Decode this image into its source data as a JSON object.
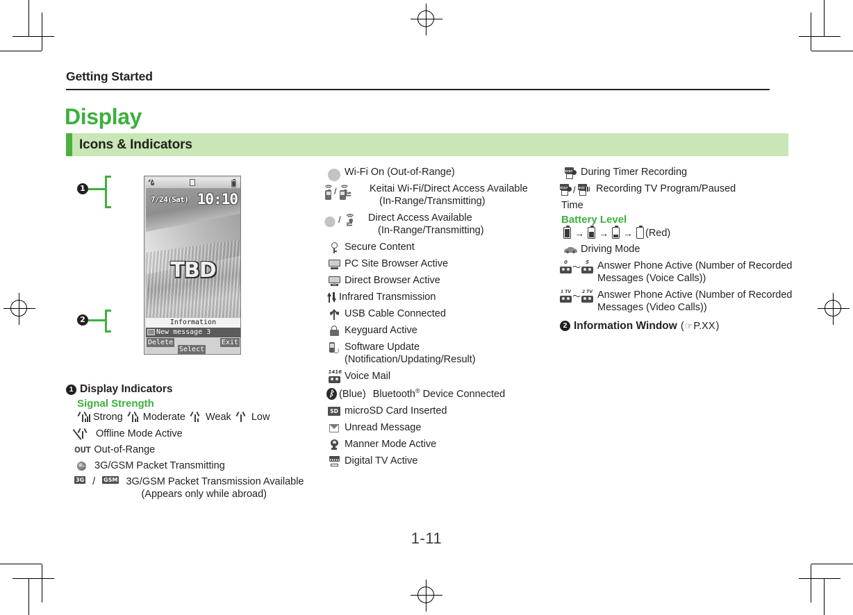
{
  "page": {
    "running_head": "Getting Started",
    "chapter_title": "Display",
    "section_title": "Icons & Indicators",
    "folio": "1-11",
    "accent_green": "#3db03d",
    "band_green": "#c8e6b6",
    "tab_green": "#4caf3e"
  },
  "phone_mock": {
    "status_bar": {
      "signal": "signal-icon",
      "center": "message-icon",
      "battery": "battery-icon"
    },
    "date": "7/24(Sat)",
    "time": "10:10",
    "wallpaper_text": "TBD",
    "info_title": "Information",
    "info_row": "New message 3",
    "softkeys": {
      "left": "Delete",
      "center": "Select",
      "right": "Exit"
    },
    "callouts": [
      {
        "num": "1",
        "target": "display-indicators"
      },
      {
        "num": "2",
        "target": "information-window"
      }
    ]
  },
  "left_column": {
    "heading_num": "1",
    "heading": "Display Indicators",
    "signal_group_title": "Signal Strength",
    "signal_levels": [
      {
        "icon": "signal-strong-icon",
        "label": "Strong"
      },
      {
        "icon": "signal-moderate-icon",
        "label": "Moderate"
      },
      {
        "icon": "signal-weak-icon",
        "label": "Weak"
      },
      {
        "icon": "signal-low-icon",
        "label": "Low"
      }
    ],
    "rows": [
      {
        "icon": "offline-mode-icon",
        "label": "Offline Mode Active",
        "sub": ""
      },
      {
        "icon": "out-of-range-text-icon",
        "icon_text": "OUT",
        "label": "Out-of-Range",
        "sub": ""
      },
      {
        "icon": "globe-packet-icon",
        "label": "3G/GSM Packet Transmitting",
        "sub": ""
      },
      {
        "icon": "3g-gsm-badge-icon",
        "label": "3G/GSM Packet Transmission Available",
        "sub": "(Appears only while abroad)",
        "badge_a": "3G",
        "badge_b": "GSM"
      }
    ]
  },
  "middle_column": {
    "rows": [
      {
        "icon": "wifi-out-of-range-icon",
        "label": "Wi-Fi On (Out-of-Range)",
        "sub": ""
      },
      {
        "icon": "keitai-wifi-direct-access-icon",
        "label": "Keitai Wi-Fi/Direct Access Available",
        "sub": "(In-Range/Transmitting)",
        "separator": "/"
      },
      {
        "icon": "direct-access-icon",
        "label": "Direct Access Available",
        "sub": "(In-Range/Transmitting)",
        "separator": "/"
      },
      {
        "icon": "secure-content-key-icon",
        "label": "Secure Content",
        "sub": ""
      },
      {
        "icon": "pc-site-browser-icon",
        "label": "PC Site Browser Active",
        "sub": ""
      },
      {
        "icon": "direct-browser-icon",
        "label": "Direct Browser Active",
        "sub": ""
      },
      {
        "icon": "infrared-transmission-icon",
        "label": "Infrared Transmission",
        "sub": ""
      },
      {
        "icon": "usb-cable-icon",
        "label": "USB Cable Connected",
        "sub": ""
      },
      {
        "icon": "keyguard-lock-icon",
        "label": "Keyguard Active",
        "sub": ""
      },
      {
        "icon": "software-update-icon",
        "label": "Software Update",
        "sub": "(Notification/Updating/Result)"
      },
      {
        "icon": "voice-mail-icon",
        "label": "Voice Mail",
        "sub": ""
      },
      {
        "icon": "bluetooth-icon",
        "label": "Bluetooth® Device Connected",
        "prefix": "(Blue)",
        "sub": ""
      },
      {
        "icon": "microsd-card-icon",
        "label": "microSD Card Inserted",
        "sub": "",
        "badge": "SD"
      },
      {
        "icon": "unread-message-icon",
        "label": "Unread Message",
        "sub": ""
      },
      {
        "icon": "manner-mode-icon",
        "label": "Manner Mode Active",
        "sub": ""
      },
      {
        "icon": "digital-tv-icon",
        "label": "Digital TV Active",
        "sub": ""
      }
    ]
  },
  "right_column": {
    "rows_top": [
      {
        "icon": "timer-recording-icon",
        "label": "During Timer Recording",
        "sub": ""
      },
      {
        "icon": "recording-tv-program-icon",
        "label": "Recording TV Program/Paused",
        "sub": "",
        "separator": "/"
      }
    ],
    "time_label": "Time",
    "battery_group_title": "Battery Level",
    "battery_levels": [
      "battery-full-icon",
      "battery-high-icon",
      "battery-mid-icon",
      "battery-empty-icon"
    ],
    "battery_arrow": "→",
    "battery_note": "(Red)",
    "rows_bottom": [
      {
        "icon": "driving-mode-icon",
        "label": "Driving Mode",
        "sub": ""
      },
      {
        "icon": "answer-phone-voice-icon",
        "label": "Answer Phone Active (Number of Recorded",
        "sub": "Messages (Voice Calls))",
        "range_from": "0",
        "range_to": "5",
        "tilde": "～"
      },
      {
        "icon": "answer-phone-video-icon",
        "label": "Answer Phone Active (Number of Recorded",
        "sub": "Messages (Video Calls))",
        "range_from": "1 TV",
        "range_to": "2 TV",
        "tilde": "～"
      }
    ],
    "info_window": {
      "num": "2",
      "label": "Information Window",
      "ref_open": "(",
      "ref_icon": "pointing-hand-icon",
      "ref_text": "P.XX",
      "ref_close": ")"
    }
  }
}
